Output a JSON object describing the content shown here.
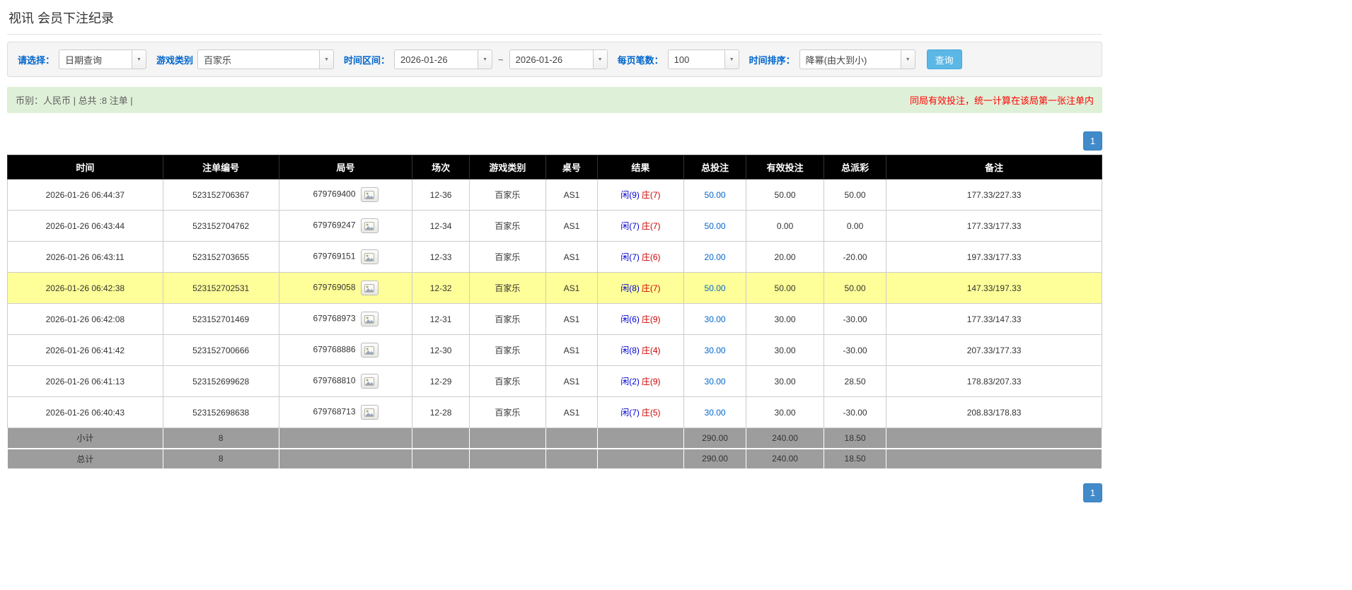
{
  "page": {
    "title": "视讯 会员下注纪录"
  },
  "colors": {
    "label_blue": "#0066cc",
    "link_blue": "#0066cc",
    "player_blue": "#0000cc",
    "banker_red": "#cc0000",
    "negative_red": "#ff0000",
    "highlight_yellow": "#ffff99",
    "header_bg": "#000000",
    "footer_bg": "#9d9d9d",
    "search_button_blue": "#5bb7e5",
    "pagination_blue": "#428bca",
    "summary_bg": "#dff0d8",
    "notice_red": "#ff0000"
  },
  "icons": {
    "dropdown_caret": "▼",
    "replay": "film-frame-icon"
  },
  "filters": {
    "select_label": "请选择：",
    "select_value": "日期查询",
    "game_label": "游戏类别",
    "game_value": "百家乐",
    "range_label": "时间区间：",
    "date_from": "2026-01-26",
    "range_separator": "~",
    "date_to": "2026-01-26",
    "per_page_label": "每页笔数：",
    "per_page_value": "100",
    "sort_label": "时间排序：",
    "sort_value": "降幂(由大到小)",
    "search_button_label": "查询"
  },
  "summary": {
    "currency_info": "币别：人民币 | 总共 :8 注单 |",
    "notice": "同局有效投注，统一计算在该局第一张注单内"
  },
  "pagination": {
    "page_top": "1",
    "page_bottom": "1"
  },
  "table": {
    "headers": [
      "时间",
      "注单编号",
      "局号",
      "场次",
      "游戏类别",
      "桌号",
      "结果",
      "总投注",
      "有效投注",
      "总派彩",
      "备注"
    ],
    "rows": [
      {
        "time": "2026-01-26 06:44:37",
        "bet_id": "523152706367",
        "round": "679769400",
        "session": "12-36",
        "game": "百家乐",
        "table_no": "AS1",
        "result_player": "闲(9)",
        "result_banker": "庄(7)",
        "total_bet": "50.00",
        "valid_bet": "50.00",
        "payout": "50.00",
        "note": "177.33/227.33",
        "highlighted": false
      },
      {
        "time": "2026-01-26 06:43:44",
        "bet_id": "523152704762",
        "round": "679769247",
        "session": "12-34",
        "game": "百家乐",
        "table_no": "AS1",
        "result_player": "闲(7)",
        "result_banker": "庄(7)",
        "total_bet": "50.00",
        "valid_bet": "0.00",
        "payout": "0.00",
        "note": "177.33/177.33",
        "highlighted": false
      },
      {
        "time": "2026-01-26 06:43:11",
        "bet_id": "523152703655",
        "round": "679769151",
        "session": "12-33",
        "game": "百家乐",
        "table_no": "AS1",
        "result_player": "闲(7)",
        "result_banker": "庄(6)",
        "total_bet": "20.00",
        "valid_bet": "20.00",
        "payout": "-20.00",
        "note": "197.33/177.33",
        "highlighted": false
      },
      {
        "time": "2026-01-26 06:42:38",
        "bet_id": "523152702531",
        "round": "679769058",
        "session": "12-32",
        "game": "百家乐",
        "table_no": "AS1",
        "result_player": "闲(8)",
        "result_banker": "庄(7)",
        "total_bet": "50.00",
        "valid_bet": "50.00",
        "payout": "50.00",
        "note": "147.33/197.33",
        "highlighted": true
      },
      {
        "time": "2026-01-26 06:42:08",
        "bet_id": "523152701469",
        "round": "679768973",
        "session": "12-31",
        "game": "百家乐",
        "table_no": "AS1",
        "result_player": "闲(6)",
        "result_banker": "庄(9)",
        "total_bet": "30.00",
        "valid_bet": "30.00",
        "payout": "-30.00",
        "note": "177.33/147.33",
        "highlighted": false
      },
      {
        "time": "2026-01-26 06:41:42",
        "bet_id": "523152700666",
        "round": "679768886",
        "session": "12-30",
        "game": "百家乐",
        "table_no": "AS1",
        "result_player": "闲(8)",
        "result_banker": "庄(4)",
        "total_bet": "30.00",
        "valid_bet": "30.00",
        "payout": "-30.00",
        "note": "207.33/177.33",
        "highlighted": false
      },
      {
        "time": "2026-01-26 06:41:13",
        "bet_id": "523152699628",
        "round": "679768810",
        "session": "12-29",
        "game": "百家乐",
        "table_no": "AS1",
        "result_player": "闲(2)",
        "result_banker": "庄(9)",
        "total_bet": "30.00",
        "valid_bet": "30.00",
        "payout": "28.50",
        "note": "178.83/207.33",
        "highlighted": false
      },
      {
        "time": "2026-01-26 06:40:43",
        "bet_id": "523152698638",
        "round": "679768713",
        "session": "12-28",
        "game": "百家乐",
        "table_no": "AS1",
        "result_player": "闲(7)",
        "result_banker": "庄(5)",
        "total_bet": "30.00",
        "valid_bet": "30.00",
        "payout": "-30.00",
        "note": "208.83/178.83",
        "highlighted": false
      }
    ],
    "subtotal": {
      "label": "小计",
      "count": "8",
      "total_bet": "290.00",
      "valid_bet": "240.00",
      "payout": "18.50"
    },
    "total": {
      "label": "总计",
      "count": "8",
      "total_bet": "290.00",
      "valid_bet": "240.00",
      "payout": "18.50"
    }
  }
}
